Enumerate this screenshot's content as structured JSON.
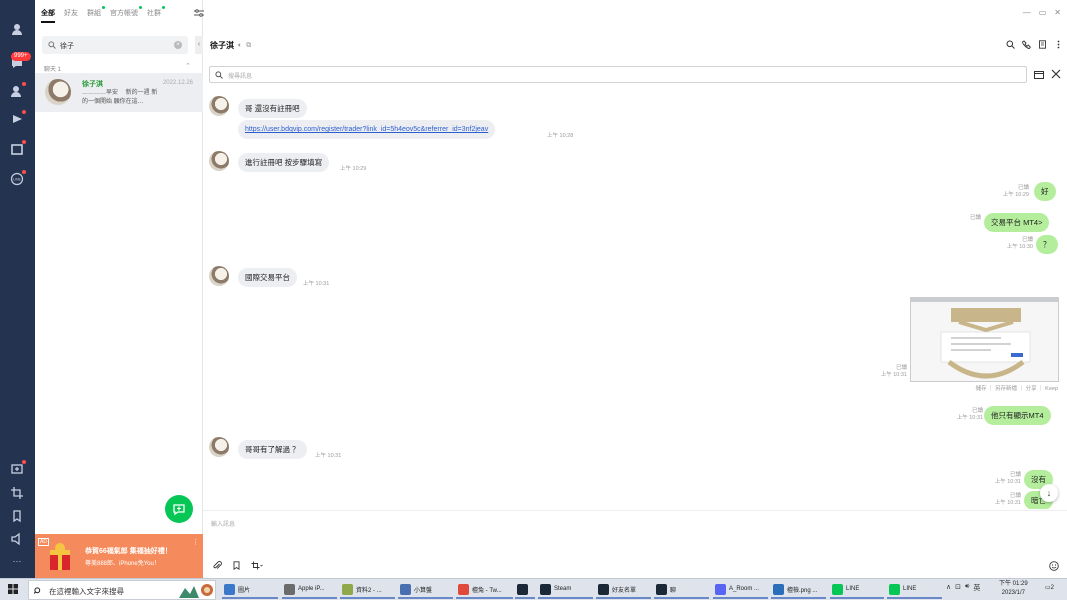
{
  "rail": {
    "badge": "999+"
  },
  "list": {
    "tabs": [
      "全部",
      "好友",
      "群組",
      "官方帳號",
      "社群"
    ],
    "search_value": "徐子",
    "section_label": "聊天 1",
    "chat_row": {
      "name": "徐子淇",
      "time": "2022.12.26",
      "preview": "…………早安　 新的一週 新的一個開始 願你在這…"
    },
    "banner": {
      "ad": "AD",
      "line1": "恭賀66福氣郎 集福抽好禮！",
      "line2": "尊美888郎、iPhone免You！"
    }
  },
  "chat": {
    "title": "徐子淇",
    "search_placeholder": "搜尋訊息",
    "compose_placeholder": "輸入訊息",
    "messages": {
      "m1": {
        "text": "哥 還沒有註冊吧"
      },
      "m2": {
        "text": "https://user.bdqvip.com/register/trader?link_id=5h4eov5c&referrer_id=3nf2jeav",
        "time": "上午 10:28"
      },
      "m3": {
        "text": "進行註冊吧 按步驟填寫",
        "time": "上午 10:29"
      },
      "m4": {
        "read": "已讀",
        "time": "上午 10:29",
        "text": "好"
      },
      "m5": {
        "read": "已讀",
        "text": "交易平台 MT4>"
      },
      "m6": {
        "read": "已讀",
        "time": "上午 10:30",
        "text": "？"
      },
      "m7": {
        "text": "國際交易平台",
        "time": "上午 10:31"
      },
      "m8": {
        "read": "已讀",
        "time": "上午 10:31",
        "caption": "儲存 ｜ 另存新檔 ｜ 分享 ｜ Keep"
      },
      "m9": {
        "read": "已讀",
        "time": "上午 10:31",
        "text": "他只有顯示MT4"
      },
      "m10": {
        "text": "哥哥有了解過 ？",
        "time": "上午 10:31"
      },
      "m11": {
        "read": "已讀",
        "time": "上午 10:31",
        "text": "沒有"
      },
      "m12": {
        "read": "已讀",
        "time": "上午 10:31",
        "text": "暗亡"
      }
    }
  },
  "taskbar": {
    "search_placeholder": "在這裡輸入文字來搜尋",
    "items": [
      {
        "label": "圖片",
        "color": "#3b78c9"
      },
      {
        "label": "Apple iP...",
        "color": "#6b6b6b"
      },
      {
        "label": "資料2 - ...",
        "color": "#8fa84a"
      },
      {
        "label": "小算盤",
        "color": "#4a6fb0"
      },
      {
        "label": "檀兔 - Tw...",
        "color": "#e04a3a"
      },
      {
        "label": "",
        "color": "#1b2838"
      },
      {
        "label": "Steam",
        "color": "#1b2838"
      },
      {
        "label": "好友名單",
        "color": "#1b2838"
      },
      {
        "label": "聊",
        "color": "#1b2838"
      },
      {
        "label": "A_Room ...",
        "color": "#5865f2"
      },
      {
        "label": "檀檢.png ...",
        "color": "#2a6db8"
      },
      {
        "label": "LINE",
        "color": "#06c755"
      },
      {
        "label": "LINE",
        "color": "#06c755"
      }
    ],
    "ime": "英",
    "time": "下午 01:29",
    "date": "2023/1/7",
    "notif_count": "2"
  }
}
